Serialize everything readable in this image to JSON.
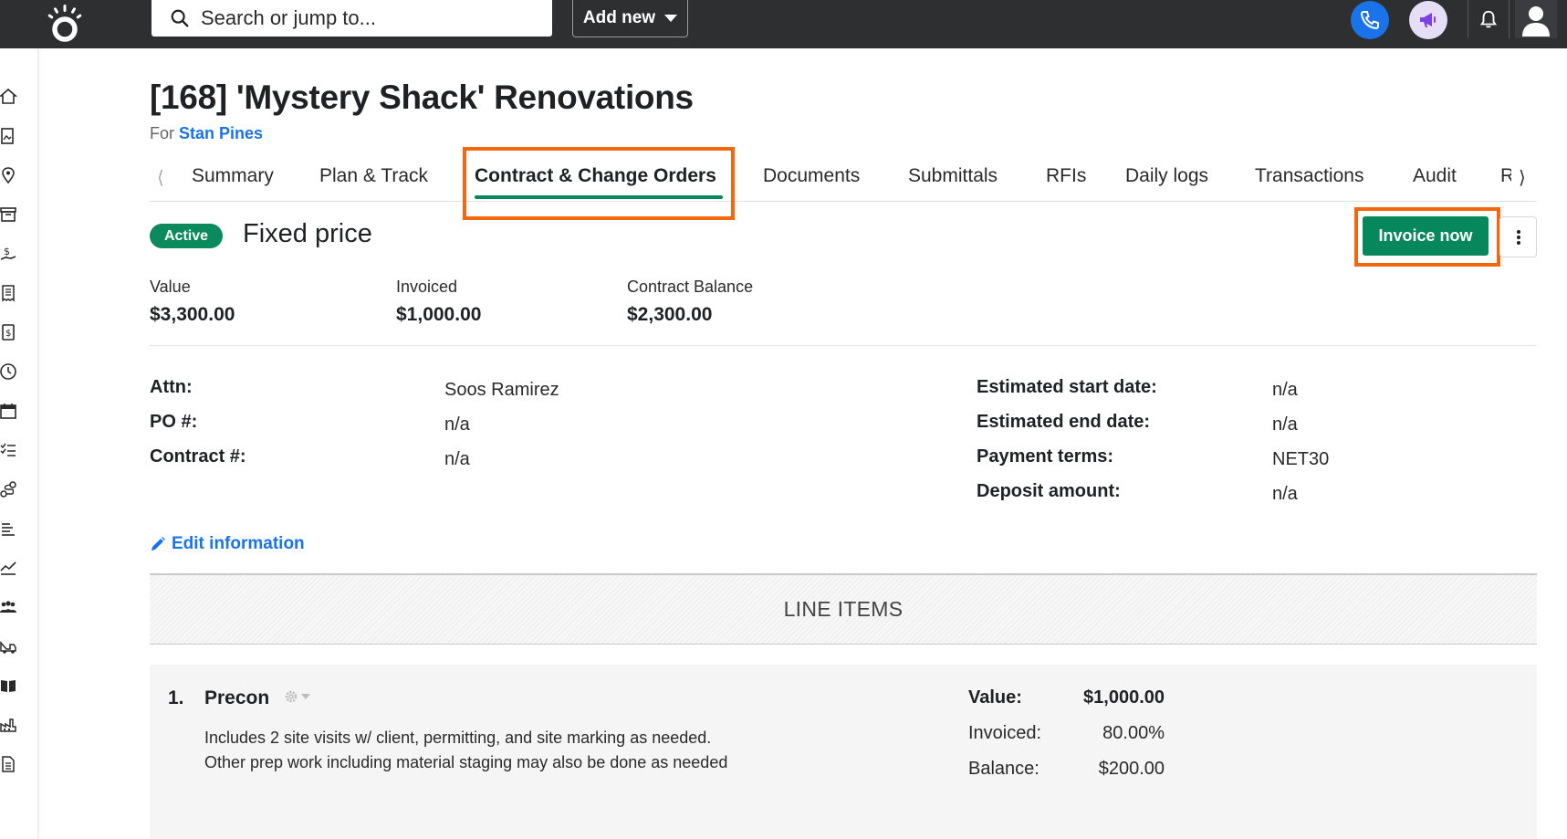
{
  "colors": {
    "brand_green": "#07875c",
    "link_blue": "#1a73e8",
    "highlight_orange": "#f4670f",
    "topbar": "#2d2f31"
  },
  "topbar": {
    "search_placeholder": "Search or jump to...",
    "add_new_label": "Add new"
  },
  "sidebar": {
    "icons": [
      "home-icon",
      "photo-doc-icon",
      "location-pin-icon",
      "archive-icon",
      "money-hand-icon",
      "receipt-icon",
      "invoice-dollar-icon",
      "clock-icon",
      "calendar-icon",
      "checklist-icon",
      "workflow-icon",
      "list-icon",
      "trend-chart-icon",
      "team-icon",
      "truck-icon",
      "book-icon",
      "factory-icon",
      "document-icon"
    ]
  },
  "project": {
    "title": "[168] 'Mystery Shack' Renovations",
    "for_prefix": "For",
    "client": "Stan Pines"
  },
  "tabs": [
    {
      "label": "Summary"
    },
    {
      "label": "Plan & Track"
    },
    {
      "label": "Contract & Change Orders",
      "active": true
    },
    {
      "label": "Documents"
    },
    {
      "label": "Submittals"
    },
    {
      "label": "RFIs"
    },
    {
      "label": "Daily logs"
    },
    {
      "label": "Transactions"
    },
    {
      "label": "Audit"
    },
    {
      "label": "R"
    }
  ],
  "contract": {
    "status": "Active",
    "type": "Fixed price",
    "invoice_button": "Invoice now",
    "summary": [
      {
        "label": "Value",
        "value": "$3,300.00"
      },
      {
        "label": "Invoiced",
        "value": "$1,000.00"
      },
      {
        "label": "Contract Balance",
        "value": "$2,300.00"
      }
    ],
    "info_left": [
      {
        "label": "Attn:",
        "value": "Soos Ramirez"
      },
      {
        "label": "PO #:",
        "value": "n/a"
      },
      {
        "label": "Contract #:",
        "value": "n/a"
      }
    ],
    "info_right": [
      {
        "label": "Estimated start date:",
        "value": "n/a"
      },
      {
        "label": "Estimated end date:",
        "value": "n/a"
      },
      {
        "label": "Payment terms:",
        "value": "NET30"
      },
      {
        "label": "Deposit amount:",
        "value": "n/a"
      }
    ],
    "edit_link": "Edit information"
  },
  "line_items": {
    "header": "LINE ITEMS",
    "items": [
      {
        "number": "1.",
        "name": "Precon",
        "description": [
          "Includes 2 site visits w/ client, permitting, and site marking as needed.",
          "Other prep work including material staging may also be done as needed"
        ],
        "value_label": "Value:",
        "value": "$1,000.00",
        "invoiced_label": "Invoiced:",
        "invoiced": "80.00%",
        "balance_label": "Balance:",
        "balance": "$200.00"
      }
    ]
  }
}
